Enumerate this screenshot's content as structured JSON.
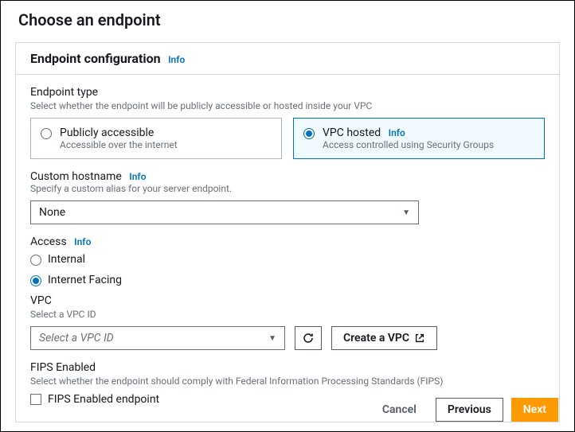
{
  "page": {
    "title": "Choose an endpoint"
  },
  "panel": {
    "title": "Endpoint configuration",
    "info": "Info"
  },
  "endpointType": {
    "label": "Endpoint type",
    "desc": "Select whether the endpoint will be publicly accessible or hosted inside your VPC",
    "options": [
      {
        "title": "Publicly accessible",
        "desc": "Accessible over the internet"
      },
      {
        "title": "VPC hosted",
        "info": "Info",
        "desc": "Access controlled using Security Groups"
      }
    ]
  },
  "customHostname": {
    "label": "Custom hostname",
    "info": "Info",
    "desc": "Specify a custom alias for your server endpoint.",
    "value": "None"
  },
  "access": {
    "label": "Access",
    "info": "Info",
    "options": [
      "Internal",
      "Internet Facing"
    ]
  },
  "vpc": {
    "label": "VPC",
    "desc": "Select a VPC ID",
    "placeholder": "Select a VPC ID",
    "createLabel": "Create a VPC"
  },
  "fips": {
    "label": "FIPS Enabled",
    "desc": "Select whether the endpoint should comply with Federal Information Processing Standards (FIPS)",
    "checkboxLabel": "FIPS Enabled endpoint"
  },
  "footer": {
    "cancel": "Cancel",
    "previous": "Previous",
    "next": "Next"
  }
}
